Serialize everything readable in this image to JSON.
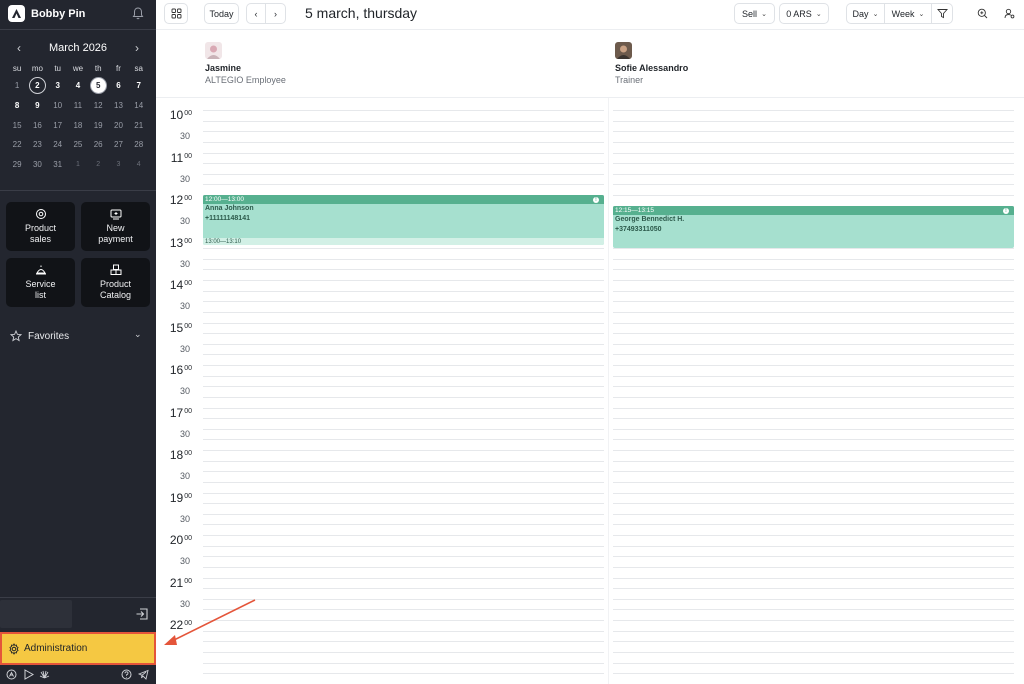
{
  "sidebar": {
    "brand": "Bobby Pin",
    "calendar": {
      "title": "March 2026",
      "weekdays": [
        "su",
        "mo",
        "tu",
        "we",
        "th",
        "fr",
        "sa"
      ],
      "days": [
        "1",
        "2",
        "3",
        "4",
        "5",
        "6",
        "7",
        "8",
        "9",
        "10",
        "11",
        "12",
        "13",
        "14",
        "15",
        "16",
        "17",
        "18",
        "19",
        "20",
        "21",
        "22",
        "23",
        "24",
        "25",
        "26",
        "27",
        "28",
        "29",
        "30",
        "31",
        "1",
        "2",
        "3",
        "4"
      ],
      "selected_day": "2",
      "today": "5"
    },
    "tiles": [
      {
        "label_1": "Product",
        "label_2": "sales",
        "icon": "product-sales-icon"
      },
      {
        "label_1": "New",
        "label_2": "payment",
        "icon": "new-payment-icon"
      },
      {
        "label_1": "Service",
        "label_2": "list",
        "icon": "service-list-icon"
      },
      {
        "label_1": "Product",
        "label_2": "Catalog",
        "icon": "product-catalog-icon"
      }
    ],
    "favorites": "Favorites",
    "administration": "Administration"
  },
  "topbar": {
    "today": "Today",
    "date_title": "5 march, thursday",
    "sell": "Sell",
    "currency": "0 ARS",
    "day": "Day",
    "week": "Week"
  },
  "staff": [
    {
      "name": "Jasmine",
      "role": "ALTEGIO Employee"
    },
    {
      "name": "Sofie Alessandro",
      "role": "Trainer"
    }
  ],
  "times": {
    "hours": [
      "10",
      "11",
      "12",
      "13",
      "14",
      "15",
      "16",
      "17",
      "18",
      "19",
      "20",
      "21",
      "22"
    ],
    "minutes": "00",
    "half": "30"
  },
  "appointments": [
    {
      "time": "12:00—13:00",
      "client": "Anna Johnson",
      "phone": "+11111148141",
      "next": "13:00—13:10"
    },
    {
      "time": "12:15—13:15",
      "client": "George Bennedict H.",
      "phone": "+37493311050"
    }
  ],
  "colors": {
    "sidebar_bg": "#23262f",
    "appointment_header": "#56b08f",
    "appointment_body": "#a6e0cf",
    "admin_highlight": "#f5c842",
    "annotation": "#e4553a"
  }
}
